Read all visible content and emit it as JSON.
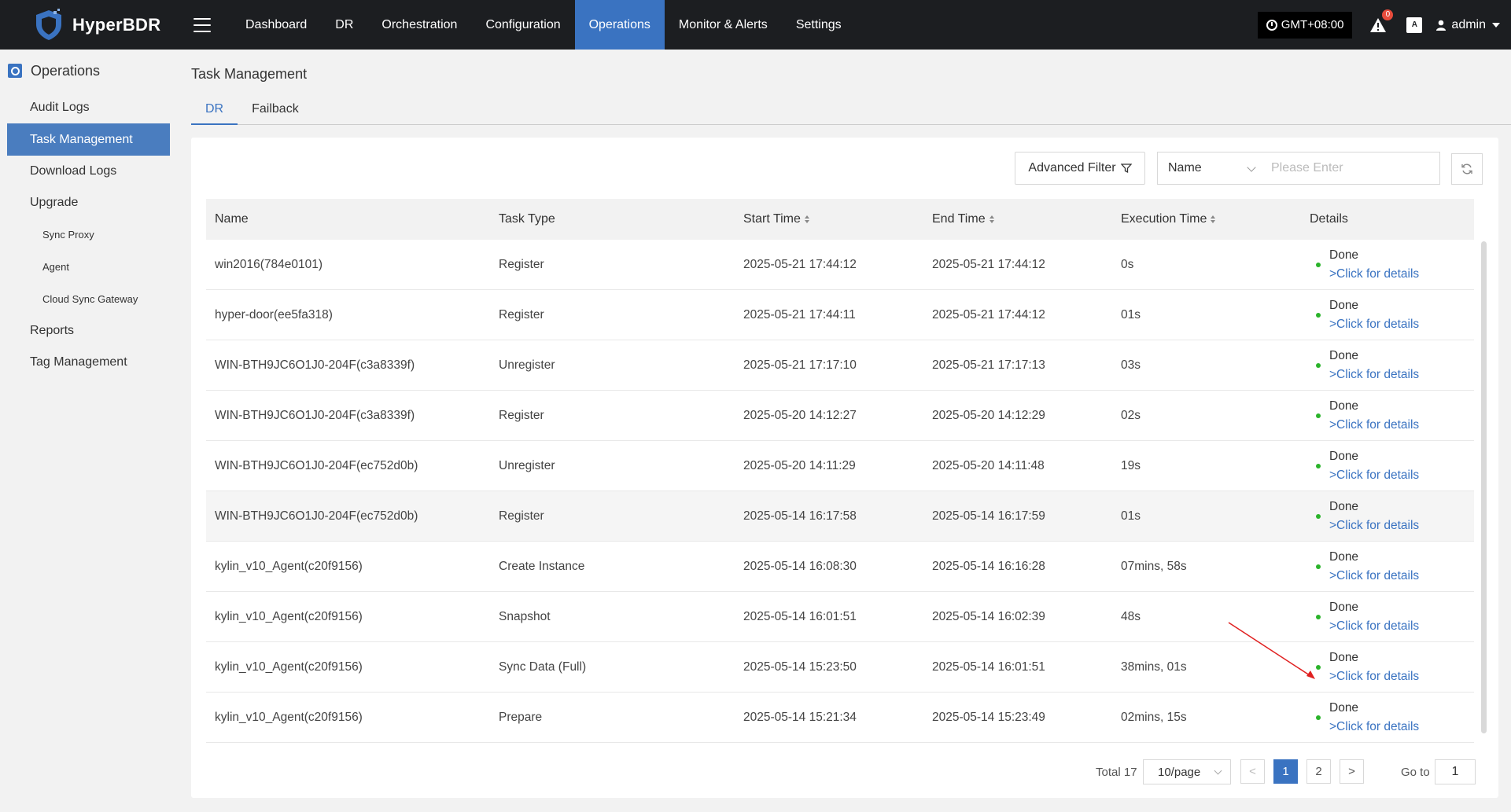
{
  "app": {
    "name": "HyperBDR"
  },
  "nav": [
    "Dashboard",
    "DR",
    "Orchestration",
    "Configuration",
    "Operations",
    "Monitor & Alerts",
    "Settings"
  ],
  "top_right": {
    "timezone": "GMT+08:00",
    "alert_count": "0",
    "lang_badge": "A",
    "user": "admin"
  },
  "sidebar": {
    "section": "Operations",
    "items": [
      {
        "label": "Audit Logs",
        "type": "item"
      },
      {
        "label": "Task Management",
        "type": "active"
      },
      {
        "label": "Download Logs",
        "type": "item"
      },
      {
        "label": "Upgrade",
        "type": "item"
      },
      {
        "label": "Sync Proxy",
        "type": "sub"
      },
      {
        "label": "Agent",
        "type": "sub"
      },
      {
        "label": "Cloud Sync Gateway",
        "type": "sub"
      },
      {
        "label": "Reports",
        "type": "item"
      },
      {
        "label": "Tag Management",
        "type": "item"
      }
    ]
  },
  "page": {
    "title": "Task Management",
    "tabs": [
      "DR",
      "Failback"
    ],
    "advanced_filter": "Advanced Filter",
    "search_field": "Name",
    "search_placeholder": "Please Enter"
  },
  "table": {
    "columns": [
      "Name",
      "Task Type",
      "Start Time",
      "End Time",
      "Execution Time",
      "Details"
    ],
    "rows": [
      {
        "name": "win2016(784e0101)",
        "type": "Register",
        "start": "2025-05-21 17:44:12",
        "end": "2025-05-21 17:44:12",
        "exec": "0s",
        "status": "Done",
        "link": ">Click for details"
      },
      {
        "name": "hyper-door(ee5fa318)",
        "type": "Register",
        "start": "2025-05-21 17:44:11",
        "end": "2025-05-21 17:44:12",
        "exec": "01s",
        "status": "Done",
        "link": ">Click for details"
      },
      {
        "name": "WIN-BTH9JC6O1J0-204F(c3a8339f)",
        "type": "Unregister",
        "start": "2025-05-21 17:17:10",
        "end": "2025-05-21 17:17:13",
        "exec": "03s",
        "status": "Done",
        "link": ">Click for details"
      },
      {
        "name": "WIN-BTH9JC6O1J0-204F(c3a8339f)",
        "type": "Register",
        "start": "2025-05-20 14:12:27",
        "end": "2025-05-20 14:12:29",
        "exec": "02s",
        "status": "Done",
        "link": ">Click for details"
      },
      {
        "name": "WIN-BTH9JC6O1J0-204F(ec752d0b)",
        "type": "Unregister",
        "start": "2025-05-20 14:11:29",
        "end": "2025-05-20 14:11:48",
        "exec": "19s",
        "status": "Done",
        "link": ">Click for details"
      },
      {
        "name": "WIN-BTH9JC6O1J0-204F(ec752d0b)",
        "type": "Register",
        "start": "2025-05-14 16:17:58",
        "end": "2025-05-14 16:17:59",
        "exec": "01s",
        "status": "Done",
        "link": ">Click for details"
      },
      {
        "name": "kylin_v10_Agent(c20f9156)",
        "type": "Create Instance",
        "start": "2025-05-14 16:08:30",
        "end": "2025-05-14 16:16:28",
        "exec": "07mins, 58s",
        "status": "Done",
        "link": ">Click for details"
      },
      {
        "name": "kylin_v10_Agent(c20f9156)",
        "type": "Snapshot",
        "start": "2025-05-14 16:01:51",
        "end": "2025-05-14 16:02:39",
        "exec": "48s",
        "status": "Done",
        "link": ">Click for details"
      },
      {
        "name": "kylin_v10_Agent(c20f9156)",
        "type": "Sync Data (Full)",
        "start": "2025-05-14 15:23:50",
        "end": "2025-05-14 16:01:51",
        "exec": "38mins, 01s",
        "status": "Done",
        "link": ">Click for details"
      },
      {
        "name": "kylin_v10_Agent(c20f9156)",
        "type": "Prepare",
        "start": "2025-05-14 15:21:34",
        "end": "2025-05-14 15:23:49",
        "exec": "02mins, 15s",
        "status": "Done",
        "link": ">Click for details"
      }
    ]
  },
  "pager": {
    "total": "Total 17",
    "page_size": "10/page",
    "prev": "<",
    "pages": [
      "1",
      "2"
    ],
    "next": ">",
    "goto_label": "Go to",
    "goto_value": "1"
  },
  "colors": {
    "accent": "#3a73c1",
    "topbar": "#1c1e21",
    "status_ok": "#2ab32a",
    "annotation": "#e02020"
  }
}
